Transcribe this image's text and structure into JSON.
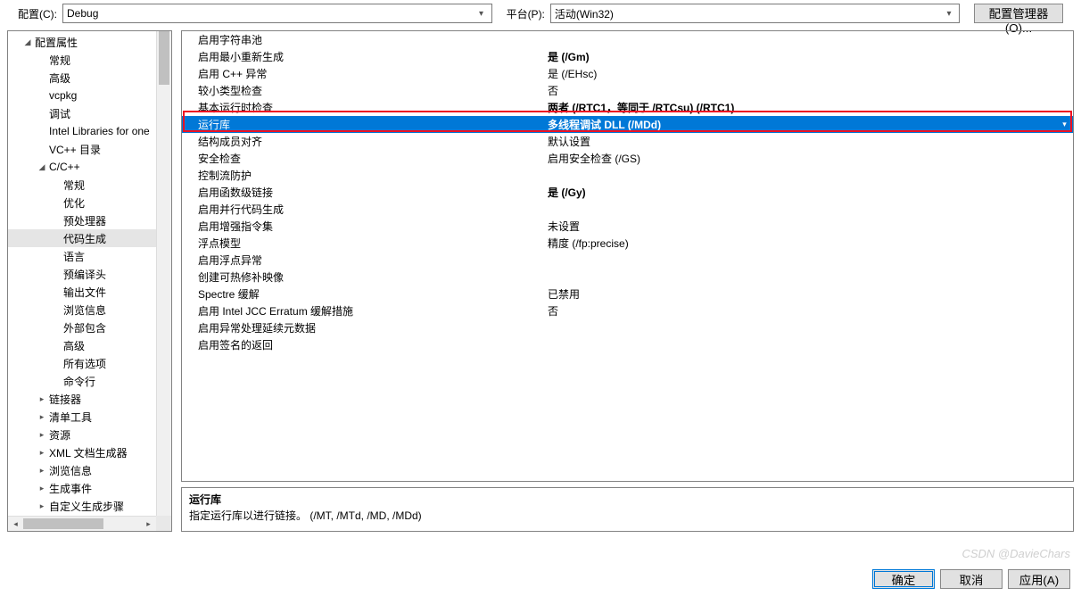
{
  "topbar": {
    "config_label": "配置(C):",
    "config_value": "Debug",
    "platform_label": "平台(P):",
    "platform_value": "活动(Win32)",
    "config_mgr_btn": "配置管理器(O)..."
  },
  "tree": {
    "root": "配置属性",
    "items": [
      {
        "label": "常规",
        "level": 2
      },
      {
        "label": "高级",
        "level": 2
      },
      {
        "label": "vcpkg",
        "level": 2
      },
      {
        "label": "调试",
        "level": 2
      },
      {
        "label": "Intel Libraries for one",
        "level": 2
      },
      {
        "label": "VC++ 目录",
        "level": 2
      }
    ],
    "cpp": "C/C++",
    "cpp_items": [
      {
        "label": "常规"
      },
      {
        "label": "优化"
      },
      {
        "label": "预处理器"
      },
      {
        "label": "代码生成",
        "selected": true
      },
      {
        "label": "语言"
      },
      {
        "label": "预编译头"
      },
      {
        "label": "输出文件"
      },
      {
        "label": "浏览信息"
      },
      {
        "label": "外部包含"
      },
      {
        "label": "高级"
      },
      {
        "label": "所有选项"
      },
      {
        "label": "命令行"
      }
    ],
    "after": [
      {
        "label": "链接器",
        "caret": true
      },
      {
        "label": "清单工具",
        "caret": true
      },
      {
        "label": "资源",
        "caret": true
      },
      {
        "label": "XML 文档生成器",
        "caret": true
      },
      {
        "label": "浏览信息",
        "caret": true
      },
      {
        "label": "生成事件",
        "caret": true
      },
      {
        "label": "自定义生成步骤",
        "caret": true
      }
    ]
  },
  "props": [
    {
      "name": "启用字符串池",
      "val": ""
    },
    {
      "name": "启用最小重新生成",
      "val": "是 (/Gm)",
      "bold": true
    },
    {
      "name": "启用 C++ 异常",
      "val": "是 (/EHsc)"
    },
    {
      "name": "较小类型检查",
      "val": "否"
    },
    {
      "name": "基本运行时检查",
      "val": "两者 (/RTC1，等同于 /RTCsu) (/RTC1)",
      "bold": true
    },
    {
      "name": "运行库",
      "val": "多线程调试 DLL (/MDd)",
      "selected": true,
      "bold": true
    },
    {
      "name": "结构成员对齐",
      "val": "默认设置"
    },
    {
      "name": "安全检查",
      "val": "启用安全检查 (/GS)"
    },
    {
      "name": "控制流防护",
      "val": ""
    },
    {
      "name": "启用函数级链接",
      "val": "是 (/Gy)",
      "bold": true
    },
    {
      "name": "启用并行代码生成",
      "val": ""
    },
    {
      "name": "启用增强指令集",
      "val": "未设置"
    },
    {
      "name": "浮点模型",
      "val": "精度 (/fp:precise)"
    },
    {
      "name": "启用浮点异常",
      "val": ""
    },
    {
      "name": "创建可热修补映像",
      "val": ""
    },
    {
      "name": "Spectre 缓解",
      "val": "已禁用"
    },
    {
      "name": "启用 Intel JCC Erratum 缓解措施",
      "val": "否"
    },
    {
      "name": "启用异常处理延续元数据",
      "val": ""
    },
    {
      "name": "启用签名的返回",
      "val": ""
    }
  ],
  "desc": {
    "title": "运行库",
    "text": "指定运行库以进行链接。       (/MT, /MTd, /MD, /MDd)"
  },
  "buttons": {
    "ok": "确定",
    "cancel": "取消",
    "apply": "应用(A)"
  },
  "watermark": "CSDN @DavieChars"
}
